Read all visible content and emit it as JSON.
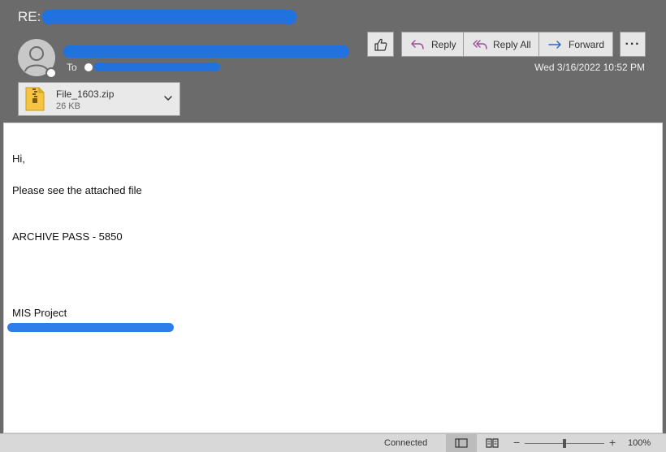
{
  "message": {
    "subject_prefix": "RE:",
    "to_label": "To",
    "date": "Wed 3/16/2022 10:52 PM"
  },
  "toolbar": {
    "like_icon": "thumbs-up-icon",
    "reply_label": "Reply",
    "reply_all_label": "Reply All",
    "forward_label": "Forward",
    "more_label": "···"
  },
  "attachment": {
    "name": "File_1603.zip",
    "size": "26 KB",
    "icon": "zip-file-icon"
  },
  "body": {
    "greeting": "Hi,",
    "line1": "Please see the attached file",
    "line2": "ARCHIVE PASS - 5850",
    "signature": "MIS Project"
  },
  "statusbar": {
    "status": "Connected",
    "zoom_minus": "−",
    "zoom_plus": "+",
    "zoom_level": "100%",
    "zoom_fraction": 0.5
  },
  "colors": {
    "header_bg": "#6b6b6b",
    "redaction": "#1a73e8",
    "reply_arrow": "#9b4f96",
    "forward_arrow": "#2b66c4"
  }
}
